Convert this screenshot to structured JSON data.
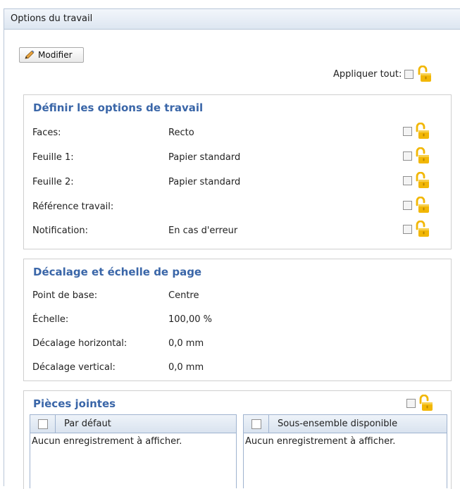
{
  "window": {
    "title": "Options du travail"
  },
  "toolbar": {
    "edit_label": "Modifier"
  },
  "apply_all": {
    "label": "Appliquer tout:"
  },
  "job_options": {
    "title": "Définir les options de travail",
    "rows": [
      {
        "label": "Faces:",
        "value": "Recto"
      },
      {
        "label": "Feuille 1:",
        "value": "Papier standard"
      },
      {
        "label": "Feuille 2:",
        "value": "Papier standard"
      },
      {
        "label": "Référence travail:",
        "value": ""
      },
      {
        "label": "Notification:",
        "value": "En cas d'erreur"
      }
    ]
  },
  "page_offset": {
    "title": "Décalage et échelle de page",
    "rows": [
      {
        "label": "Point de base:",
        "value": "Centre"
      },
      {
        "label": "Échelle:",
        "value": "100,00 %"
      },
      {
        "label": "Décalage horizontal:",
        "value": "0,0 mm"
      },
      {
        "label": "Décalage vertical:",
        "value": "0,0 mm"
      }
    ]
  },
  "attachments": {
    "title": "Pièces jointes",
    "default_grid": {
      "header": "Par défaut",
      "empty": "Aucun enregistrement à afficher."
    },
    "subset_grid": {
      "header": "Sous-ensemble disponible",
      "empty": "Aucun enregistrement à afficher."
    }
  },
  "colors": {
    "accent": "#3a66a8",
    "lock": "#f2b705"
  },
  "icons": {
    "edit": "pencil-icon",
    "lock": "unlocked-padlock-icon"
  }
}
